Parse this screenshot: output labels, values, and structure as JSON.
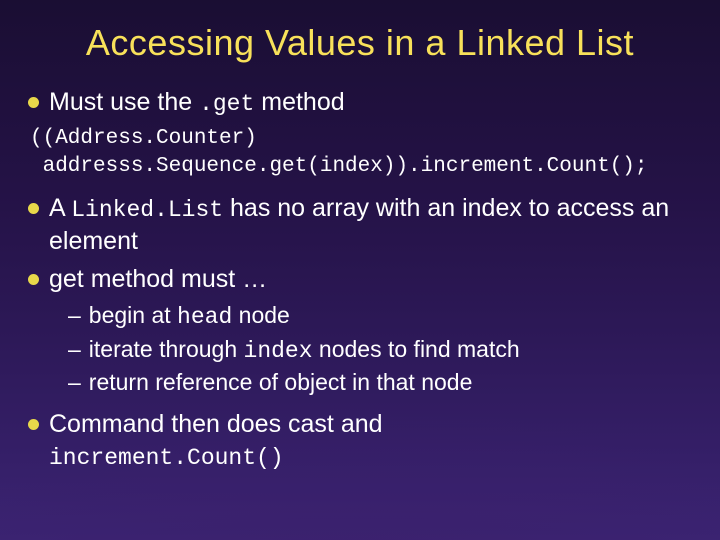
{
  "title": "Accessing Values in a Linked List",
  "b1": {
    "pre": "Must use the ",
    "code": ".get",
    "post": " method"
  },
  "codeblock": "((Address.Counter)\n addresss.Sequence.get(index)).increment.Count();",
  "b2": {
    "pre": "A ",
    "code": "Linked.List",
    "post": " has no array with an index to access an element"
  },
  "b3": "get method must …",
  "s1": {
    "pre": "begin at ",
    "code": "head",
    "post": " node"
  },
  "s2": {
    "pre": "iterate through ",
    "code": "index",
    "post": " nodes to find match"
  },
  "s3": "return reference of object in that node",
  "b4": {
    "pre": "Command then does cast and ",
    "code": "increment.Count()"
  }
}
